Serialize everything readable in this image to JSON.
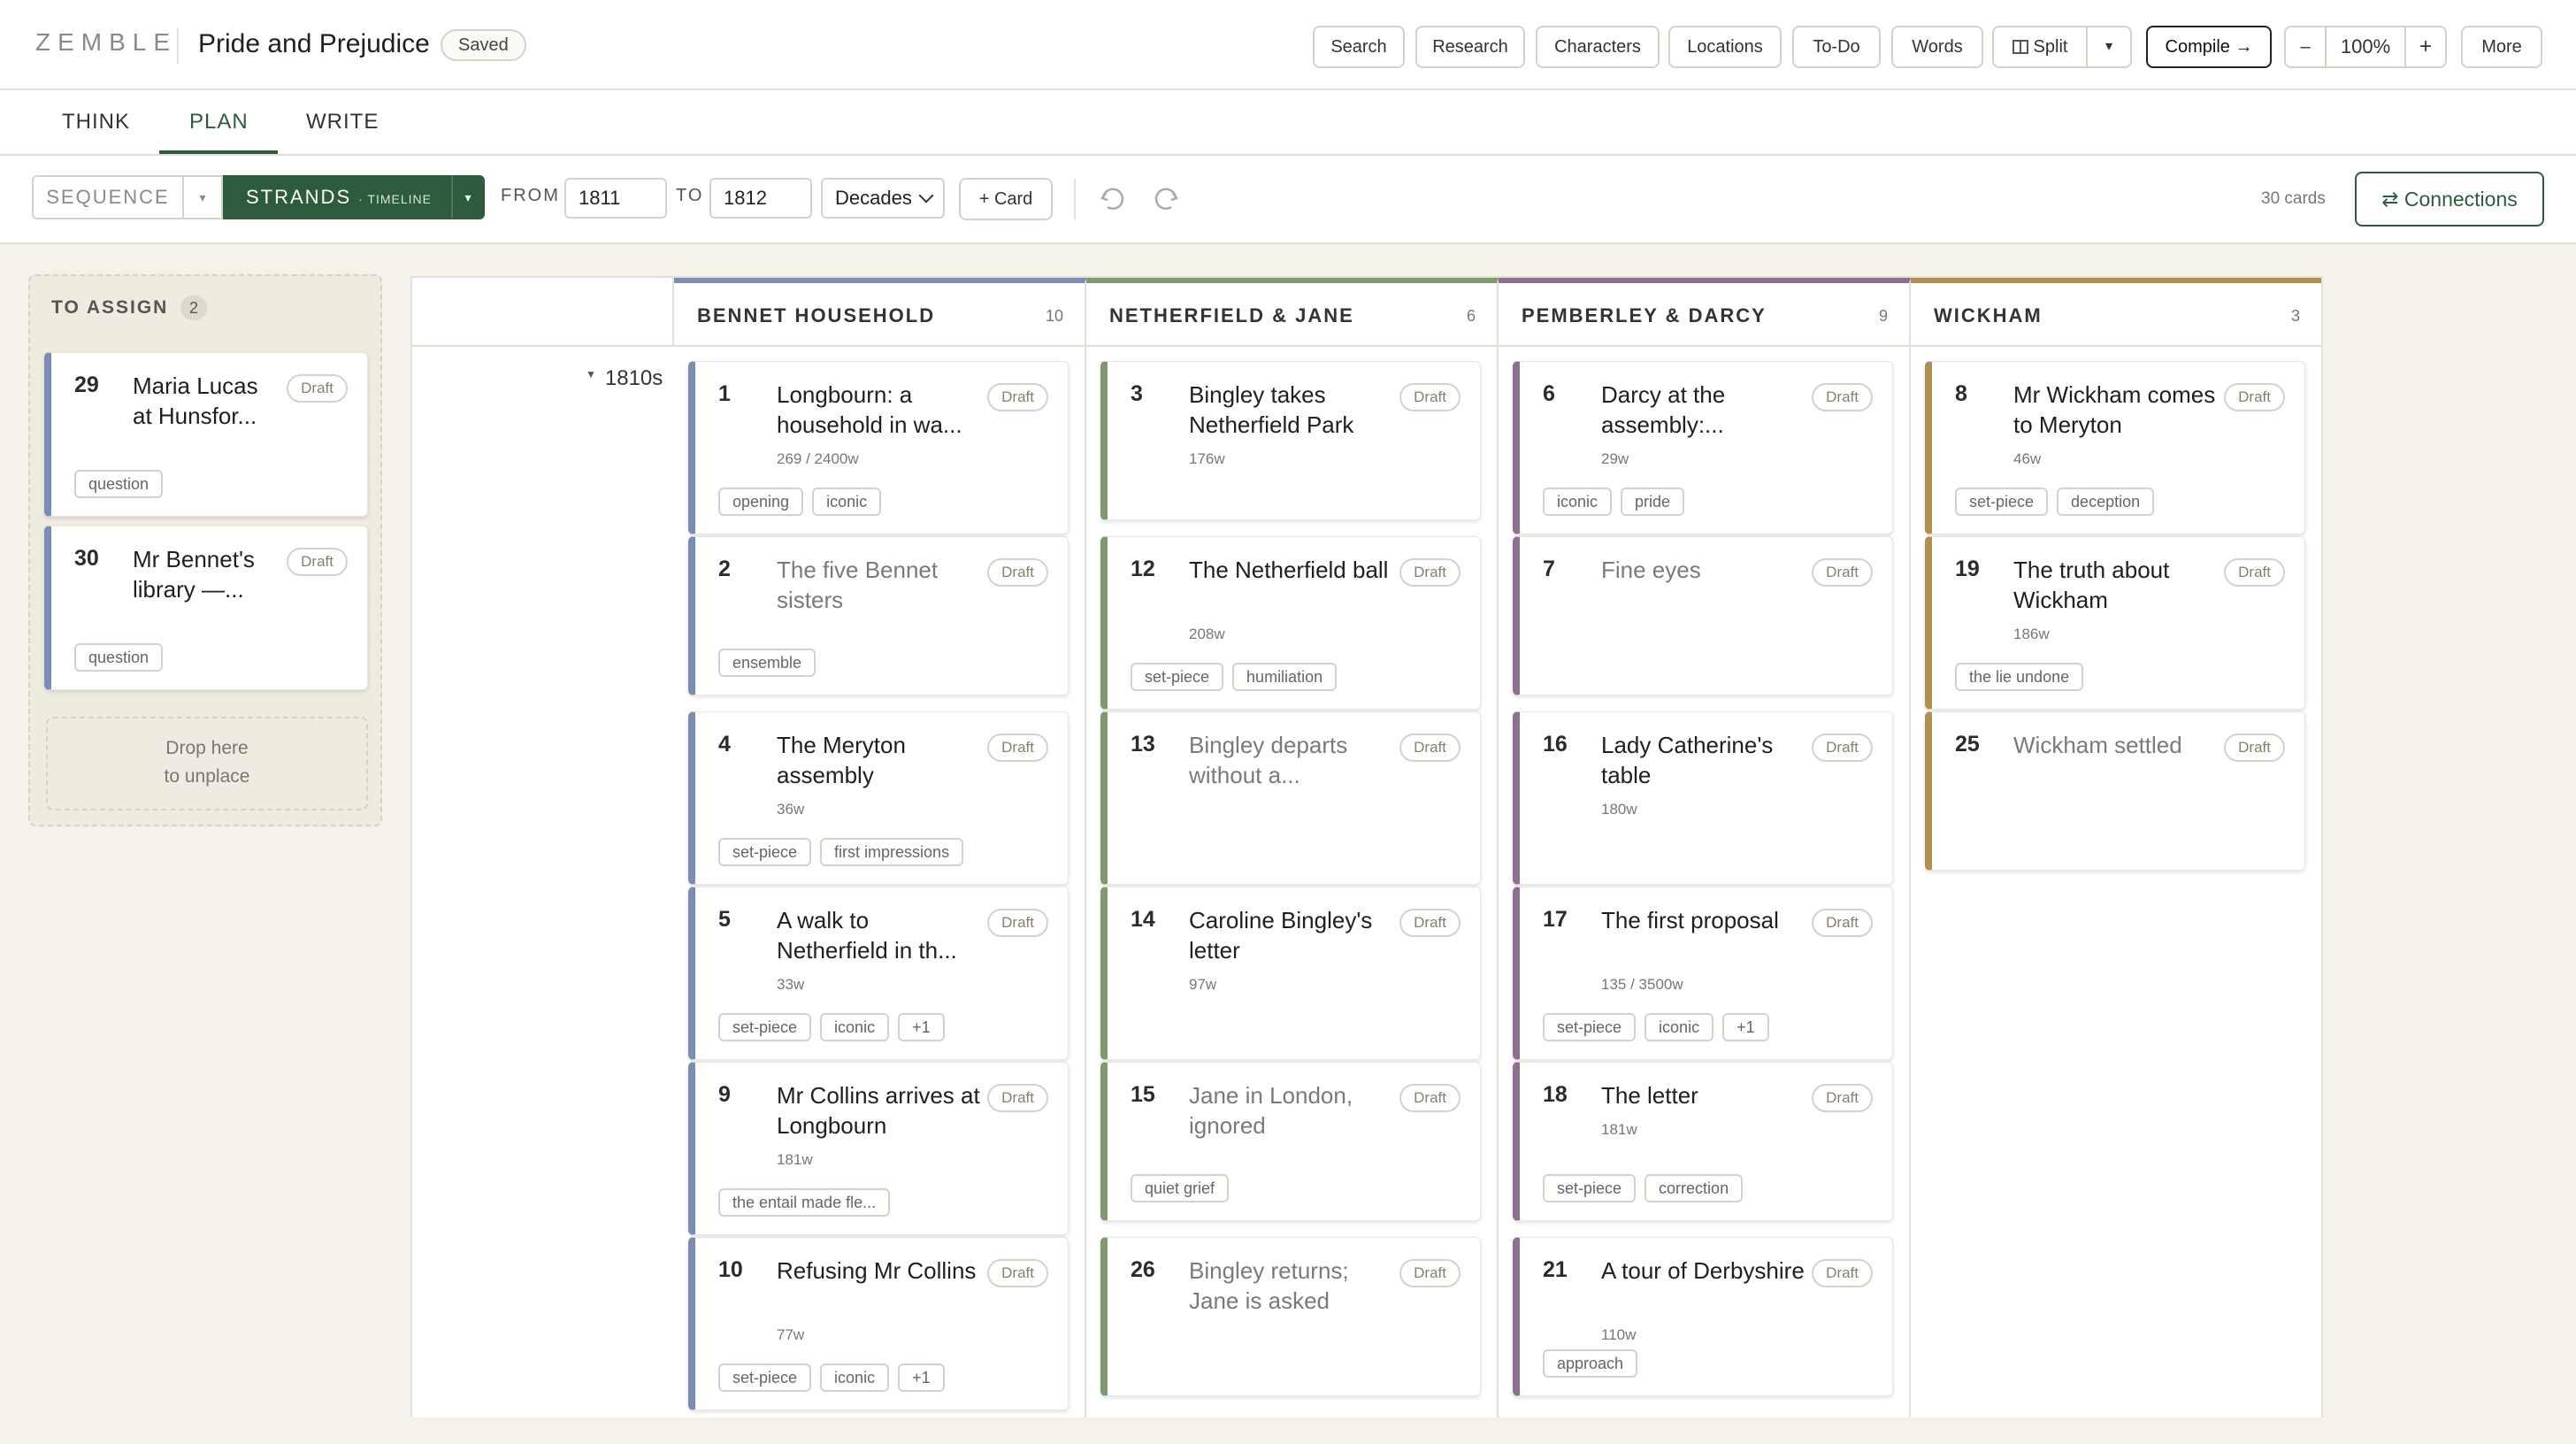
{
  "app": {
    "logo": "ZEMBLE",
    "title": "Pride and Prejudice",
    "saved": "Saved"
  },
  "toolbar_top": {
    "search": "Search",
    "research": "Research",
    "characters": "Characters",
    "locations": "Locations",
    "todo": "To-Do",
    "words": "Words",
    "split": "Split",
    "split_caret": "▾",
    "compile": "Compile →",
    "zoom_minus": "–",
    "zoom": "100%",
    "zoom_plus": "+",
    "more": "More"
  },
  "tabs": {
    "think": "THINK",
    "plan": "PLAN",
    "write": "WRITE"
  },
  "toolbar": {
    "sequence": "SEQUENCE",
    "seq_caret": "▾",
    "strands": "STRANDS",
    "timeline": "· TIMELINE",
    "strands_caret": "▾",
    "from_label": "FROM",
    "from_value": "1811",
    "to_label": "TO",
    "to_value": "1812",
    "scale": "Decades",
    "add_card": "+ Card",
    "card_count": "30 cards",
    "connections": "⇄ Connections"
  },
  "assign": {
    "title": "TO ASSIGN",
    "count": "2",
    "cards": [
      {
        "num": "29",
        "title": "Maria Lucas at Hunsfor...",
        "status": "Draft",
        "tags": [
          "question"
        ]
      },
      {
        "num": "30",
        "title": "Mr Bennet's library —...",
        "status": "Draft",
        "tags": [
          "question"
        ]
      }
    ],
    "drop_line1": "Drop here",
    "drop_line2": "to unplace"
  },
  "board": {
    "decade": "1810s",
    "columns": [
      {
        "name": "BENNET HOUSEHOLD",
        "count": "10",
        "color": "#7b8db5",
        "cards": [
          {
            "num": "1",
            "title": "Longbourn: a household in wa...",
            "status": "Draft",
            "words": "269 / 2400w",
            "tags": [
              "opening",
              "iconic"
            ]
          },
          {
            "num": "2",
            "title": "The five Bennet sisters",
            "status": "Draft",
            "muted": true,
            "tags": [
              "ensemble"
            ]
          },
          {
            "num": "4",
            "title": "The Meryton assembly",
            "status": "Draft",
            "words": "36w",
            "tags": [
              "set-piece",
              "first impressions"
            ]
          },
          {
            "num": "5",
            "title": "A walk to Netherfield in th...",
            "status": "Draft",
            "words": "33w",
            "tags": [
              "set-piece",
              "iconic",
              "+1"
            ]
          },
          {
            "num": "9",
            "title": "Mr Collins arrives at Longbourn",
            "status": "Draft",
            "words": "181w",
            "tags": [
              "the entail made fle..."
            ]
          },
          {
            "num": "10",
            "title": "Refusing Mr Collins",
            "status": "Draft",
            "words": "77w",
            "tags": [
              "set-piece",
              "iconic",
              "+1"
            ]
          }
        ]
      },
      {
        "name": "NETHERFIELD & JANE",
        "count": "6",
        "color": "#7f9a6f",
        "cards": [
          {
            "num": "3",
            "title": "Bingley takes Netherfield Park",
            "status": "Draft",
            "words": "176w",
            "tags": []
          },
          {
            "num": "12",
            "title": "The Netherfield ball",
            "status": "Draft",
            "words": "208w",
            "tags": [
              "set-piece",
              "humiliation"
            ]
          },
          {
            "num": "13",
            "title": "Bingley departs without a...",
            "status": "Draft",
            "muted": true,
            "tags": []
          },
          {
            "num": "14",
            "title": "Caroline Bingley's letter",
            "status": "Draft",
            "words": "97w",
            "tags": []
          },
          {
            "num": "15",
            "title": "Jane in London, ignored",
            "status": "Draft",
            "muted": true,
            "tags": [
              "quiet grief"
            ]
          },
          {
            "num": "26",
            "title": "Bingley returns; Jane is asked",
            "status": "Draft",
            "muted": true,
            "tags": []
          }
        ]
      },
      {
        "name": "PEMBERLEY & DARCY",
        "count": "9",
        "color": "#8f6f8f",
        "cards": [
          {
            "num": "6",
            "title": "Darcy at the assembly:...",
            "status": "Draft",
            "words": "29w",
            "tags": [
              "iconic",
              "pride"
            ]
          },
          {
            "num": "7",
            "title": "Fine eyes",
            "status": "Draft",
            "muted": true,
            "tags": []
          },
          {
            "num": "16",
            "title": "Lady Catherine's table",
            "status": "Draft",
            "words": "180w",
            "tags": []
          },
          {
            "num": "17",
            "title": "The first proposal",
            "status": "Draft",
            "words": "135 / 3500w",
            "tags": [
              "set-piece",
              "iconic",
              "+1"
            ]
          },
          {
            "num": "18",
            "title": "The letter",
            "status": "Draft",
            "words": "181w",
            "tags": [
              "set-piece",
              "correction"
            ]
          },
          {
            "num": "21",
            "title": "A tour of Derbyshire",
            "status": "Draft",
            "words": "110w",
            "tags": [
              "approach"
            ]
          }
        ]
      },
      {
        "name": "WICKHAM",
        "count": "3",
        "color": "#b08f4f",
        "cards": [
          {
            "num": "8",
            "title": "Mr Wickham comes to Meryton",
            "status": "Draft",
            "words": "46w",
            "tags": [
              "set-piece",
              "deception"
            ]
          },
          {
            "num": "19",
            "title": "The truth about Wickham",
            "status": "Draft",
            "words": "186w",
            "tags": [
              "the lie undone"
            ]
          },
          {
            "num": "25",
            "title": "Wickham settled",
            "status": "Draft",
            "muted": true,
            "tags": []
          }
        ]
      }
    ]
  }
}
